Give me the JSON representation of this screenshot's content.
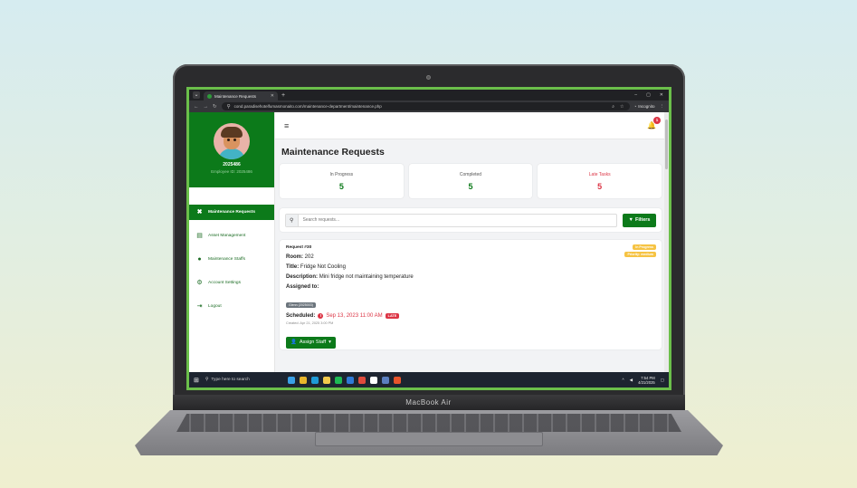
{
  "device": {
    "brand_label": "MacBook Air"
  },
  "browser": {
    "tab_title": "Maintenance Requests",
    "new_tab": "+",
    "window_controls": [
      "–",
      "▢",
      "✕"
    ],
    "url": "cond.paradisehotelfumasmonaito.com/maintenance-department/maintenance.php",
    "profile_label": "Incognito"
  },
  "sidebar": {
    "user_id": "2025486",
    "employee_label": "Employee ID: 2025486",
    "items": [
      {
        "label": "Maintenance Requests",
        "icon": "tools-icon",
        "glyph": "✖",
        "active": true
      },
      {
        "label": "Asset Management",
        "icon": "asset-icon",
        "glyph": "▤",
        "active": false
      },
      {
        "label": "Maintenance Staffs",
        "icon": "user-icon",
        "glyph": "●",
        "active": false
      },
      {
        "label": "Account Settings",
        "icon": "gears-icon",
        "glyph": "⚙",
        "active": false
      },
      {
        "label": "Logout",
        "icon": "logout-icon",
        "glyph": "⇥",
        "active": false
      }
    ]
  },
  "topbar": {
    "menu_glyph": "≡",
    "bell_glyph": "🔔",
    "notification_count": "1"
  },
  "page": {
    "title": "Maintenance Requests"
  },
  "stats": [
    {
      "label": "In Progress",
      "value": "5",
      "alert": false
    },
    {
      "label": "Completed",
      "value": "5",
      "alert": false
    },
    {
      "label": "Late Tasks",
      "value": "5",
      "alert": true
    }
  ],
  "search": {
    "placeholder": "Search requests...",
    "filters_label": "Filters"
  },
  "request": {
    "id_label": "Request #30",
    "status_badge": "In Progress",
    "priority_badge": "Priority: medium",
    "room_label": "Room:",
    "room_value": "202",
    "title_label": "Title:",
    "title_value": "Fridge Not Cooling",
    "description_label": "Description:",
    "description_value": "Mini fridge not maintaining temperature",
    "assigned_label": "Assigned to:",
    "assigned_staff": "Glenn (2025003)",
    "scheduled_label": "Scheduled:",
    "scheduled_value": "Sep 13, 2023 11:00 AM",
    "late_badge": "LATE",
    "created_label": "Created: Apr 21, 2025 3:00 PM",
    "assign_button": "Assign Staff"
  },
  "taskbar": {
    "search_placeholder": "Type here to search",
    "time": "7:54 PM",
    "date": "4/21/2025",
    "apps": [
      {
        "name": "weather-icon",
        "color": "#3aa0e6"
      },
      {
        "name": "chrome-icon",
        "color": "#e8b52b"
      },
      {
        "name": "edge-icon",
        "color": "#1e9ad6"
      },
      {
        "name": "explorer-icon",
        "color": "#f2c94c"
      },
      {
        "name": "spotify-icon",
        "color": "#1db954"
      },
      {
        "name": "store-icon",
        "color": "#2f7ad6"
      },
      {
        "name": "chrome-icon",
        "color": "#e04b3c"
      },
      {
        "name": "capcut-icon",
        "color": "#ffffff"
      },
      {
        "name": "chrome-active-icon",
        "color": "#5b7fbf"
      },
      {
        "name": "office-icon",
        "color": "#e8542b"
      }
    ]
  },
  "colors": {
    "primary": "#0c7a1a",
    "danger": "#dc3545",
    "warning": "#f6c343",
    "frame": "#6bbf4a"
  }
}
